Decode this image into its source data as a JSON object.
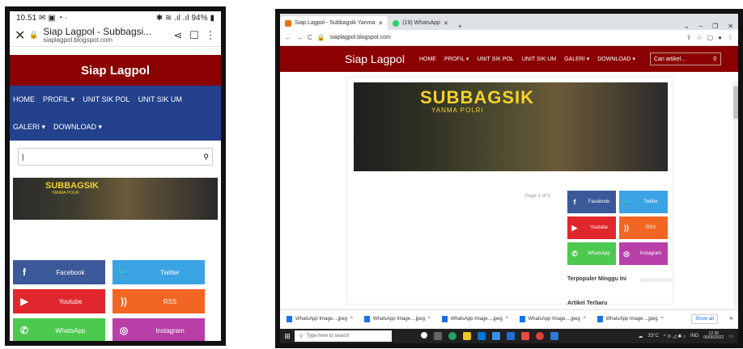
{
  "colors": {
    "brand_red": "#8b0000",
    "nav_blue": "#23418c",
    "facebook": "#3b5998",
    "twitter": "#3aa3e3",
    "youtube": "#e0272d",
    "rss": "#f26522",
    "whatsapp": "#4cc94f",
    "instagram": "#b83fa8",
    "banner_yellow": "#f4d12b"
  },
  "phone": {
    "status": {
      "time": "10.51",
      "battery": "94%"
    },
    "tab_title": "Siap Lagpol - Subbagsi...",
    "url": "siaplagpol.blogspot.com",
    "brand": "Siap Lagpol",
    "nav": [
      "HOME",
      "PROFIL ▾",
      "UNIT SIK POL",
      "UNIT SIK UM",
      "GALERI ▾",
      "DOWNLOAD ▾"
    ],
    "banner_title": "SUBBAGSIK",
    "banner_sub": "YANMA POLRI",
    "social": [
      {
        "icon": "f",
        "label": "Facebook",
        "icon_name": "facebook-icon"
      },
      {
        "icon": "🐦",
        "label": "Twitter",
        "icon_name": "twitter-icon"
      },
      {
        "icon": "▶",
        "label": "Youtube",
        "icon_name": "youtube-icon"
      },
      {
        "icon": "))",
        "label": "RSS",
        "icon_name": "rss-icon"
      },
      {
        "icon": "✆",
        "label": "WhatsApp",
        "icon_name": "whatsapp-icon"
      },
      {
        "icon": "◎",
        "label": "Instagram",
        "icon_name": "instagram-icon"
      }
    ]
  },
  "desktop": {
    "tabs": [
      {
        "title": "Siap Lagpol - Subbagsik Yanma",
        "active": true
      },
      {
        "title": "(19) WhatsApp",
        "active": false
      }
    ],
    "url": "siaplagpol.blogspot.com",
    "brand": "Siap Lagpol",
    "nav": [
      "HOME",
      "PROFIL ▾",
      "UNIT SIK POL",
      "UNIT SIK UM",
      "GALERI ▾",
      "DOWNLOAD ▾"
    ],
    "search_placeholder": "Cari artikel...",
    "banner_title": "SUBBAGSIK",
    "banner_sub": "YANMA POLRI",
    "page_of": "Page 1 of 3",
    "social": [
      {
        "icon": "f",
        "label": "Facebook",
        "icon_name": "facebook-icon"
      },
      {
        "icon": "🐦",
        "label": "Twitter",
        "icon_name": "twitter-icon"
      },
      {
        "icon": "▶",
        "label": "Youtube",
        "icon_name": "youtube-icon"
      },
      {
        "icon": "))",
        "label": "RSS",
        "icon_name": "rss-icon"
      },
      {
        "icon": "✆",
        "label": "WhatsApp",
        "icon_name": "whatsapp-icon"
      },
      {
        "icon": "◎",
        "label": "Instagram",
        "icon_name": "instagram-icon"
      }
    ],
    "popular_heading": "Terpopuler Minggu Ini",
    "artikel_heading": "Artikel Terbaru",
    "downloads": [
      "WhatsApp Image....jpeg",
      "WhatsApp Image....jpeg",
      "WhatsApp Image....jpeg",
      "WhatsApp Image....jpeg",
      "WhatsApp Image....jpeg"
    ],
    "show_all": "Show all",
    "taskbar": {
      "search_placeholder": "Type here to search",
      "weather": "33°C",
      "lang": "IND",
      "time": "12.36",
      "date": "06/05/2022"
    }
  }
}
